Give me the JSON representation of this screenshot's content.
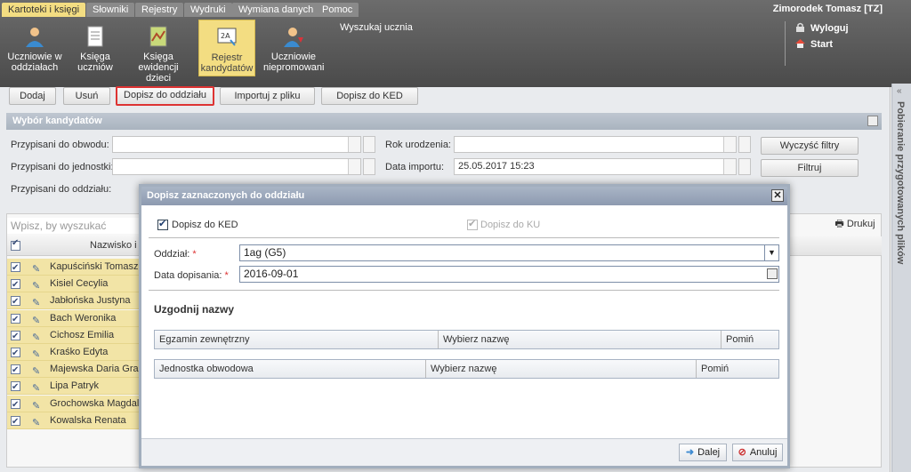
{
  "menu": {
    "items": [
      "Kartoteki i księgi",
      "Słowniki",
      "Rejestry",
      "Wydruki",
      "Wymiana danych",
      "Pomoc"
    ],
    "active_index": 0
  },
  "user": {
    "name": "Zimorodek Tomasz [TZ]"
  },
  "toolbar": {
    "tools": [
      {
        "line1": "Uczniowie w",
        "line2": "oddziałach",
        "icon": "student-icon"
      },
      {
        "line1": "Księga",
        "line2": "uczniów",
        "icon": "book-icon"
      },
      {
        "line1": "Księga",
        "line2": "ewidencji dzieci",
        "icon": "book-map-icon"
      },
      {
        "line1": "Rejestr",
        "line2": "kandydatów",
        "icon": "register-icon"
      },
      {
        "line1": "Uczniowie",
        "line2": "niepromowani",
        "icon": "student-down-icon"
      }
    ],
    "search_title": "Wyszukaj ucznia",
    "logout": "Wyloguj",
    "start": "Start"
  },
  "actions": {
    "add": "Dodaj",
    "remove": "Usuń",
    "assign_class": "Dopisz do oddziału",
    "import_file": "Importuj z pliku",
    "assign_ked": "Dopisz do KED"
  },
  "filters": {
    "title": "Wybór kandydatów",
    "district_label": "Przypisani do obwodu:",
    "unit_label": "Przypisani do jednostki:",
    "class_label": "Przypisani do oddziału:",
    "birth_year_label": "Rok urodzenia:",
    "import_date_label": "Data importu:",
    "import_date_value": "25.05.2017 15:23",
    "clear_button": "Wyczyść filtry",
    "filter_button": "Filtruj"
  },
  "list": {
    "search_placeholder": "Wpisz, by wyszukać",
    "print_button": "Drukuj",
    "name_column": "Nazwisko i i",
    "rows": [
      "Kapuściński Tomasz",
      "Kisiel Cecylia",
      "Jabłońska Justyna",
      "Bach Weronika",
      "Cichosz Emilia",
      "Kraśko Edyta",
      "Majewska Daria Grażyna",
      "Lipa Patryk",
      "Grochowska Magdalena",
      "Kowalska Renata"
    ]
  },
  "side_panel": {
    "label": "Pobieranie przygotowanych plików"
  },
  "dialog": {
    "title": "Dopisz zaznaczonych do oddziału",
    "ked_label": "Dopisz do KED",
    "ku_label": "Dopisz do KU",
    "class_label": "Oddział:",
    "class_value": "1ag (G5)",
    "date_label": "Data dopisania:",
    "date_value": "2016-09-01",
    "required_mark": "*",
    "section_title": "Uzgodnij nazwy",
    "table1": {
      "c1": "Egzamin zewnętrzny",
      "c2": "Wybierz nazwę",
      "c3": "Pomiń"
    },
    "table2": {
      "c1": "Jednostka obwodowa",
      "c2": "Wybierz nazwę",
      "c3": "Pomiń"
    },
    "next_button": "Dalej",
    "cancel_button": "Anuluj"
  },
  "colors": {
    "accent": "#f3dd82",
    "highlight": "#dd3333",
    "row_bg": "#f2e4a6"
  }
}
